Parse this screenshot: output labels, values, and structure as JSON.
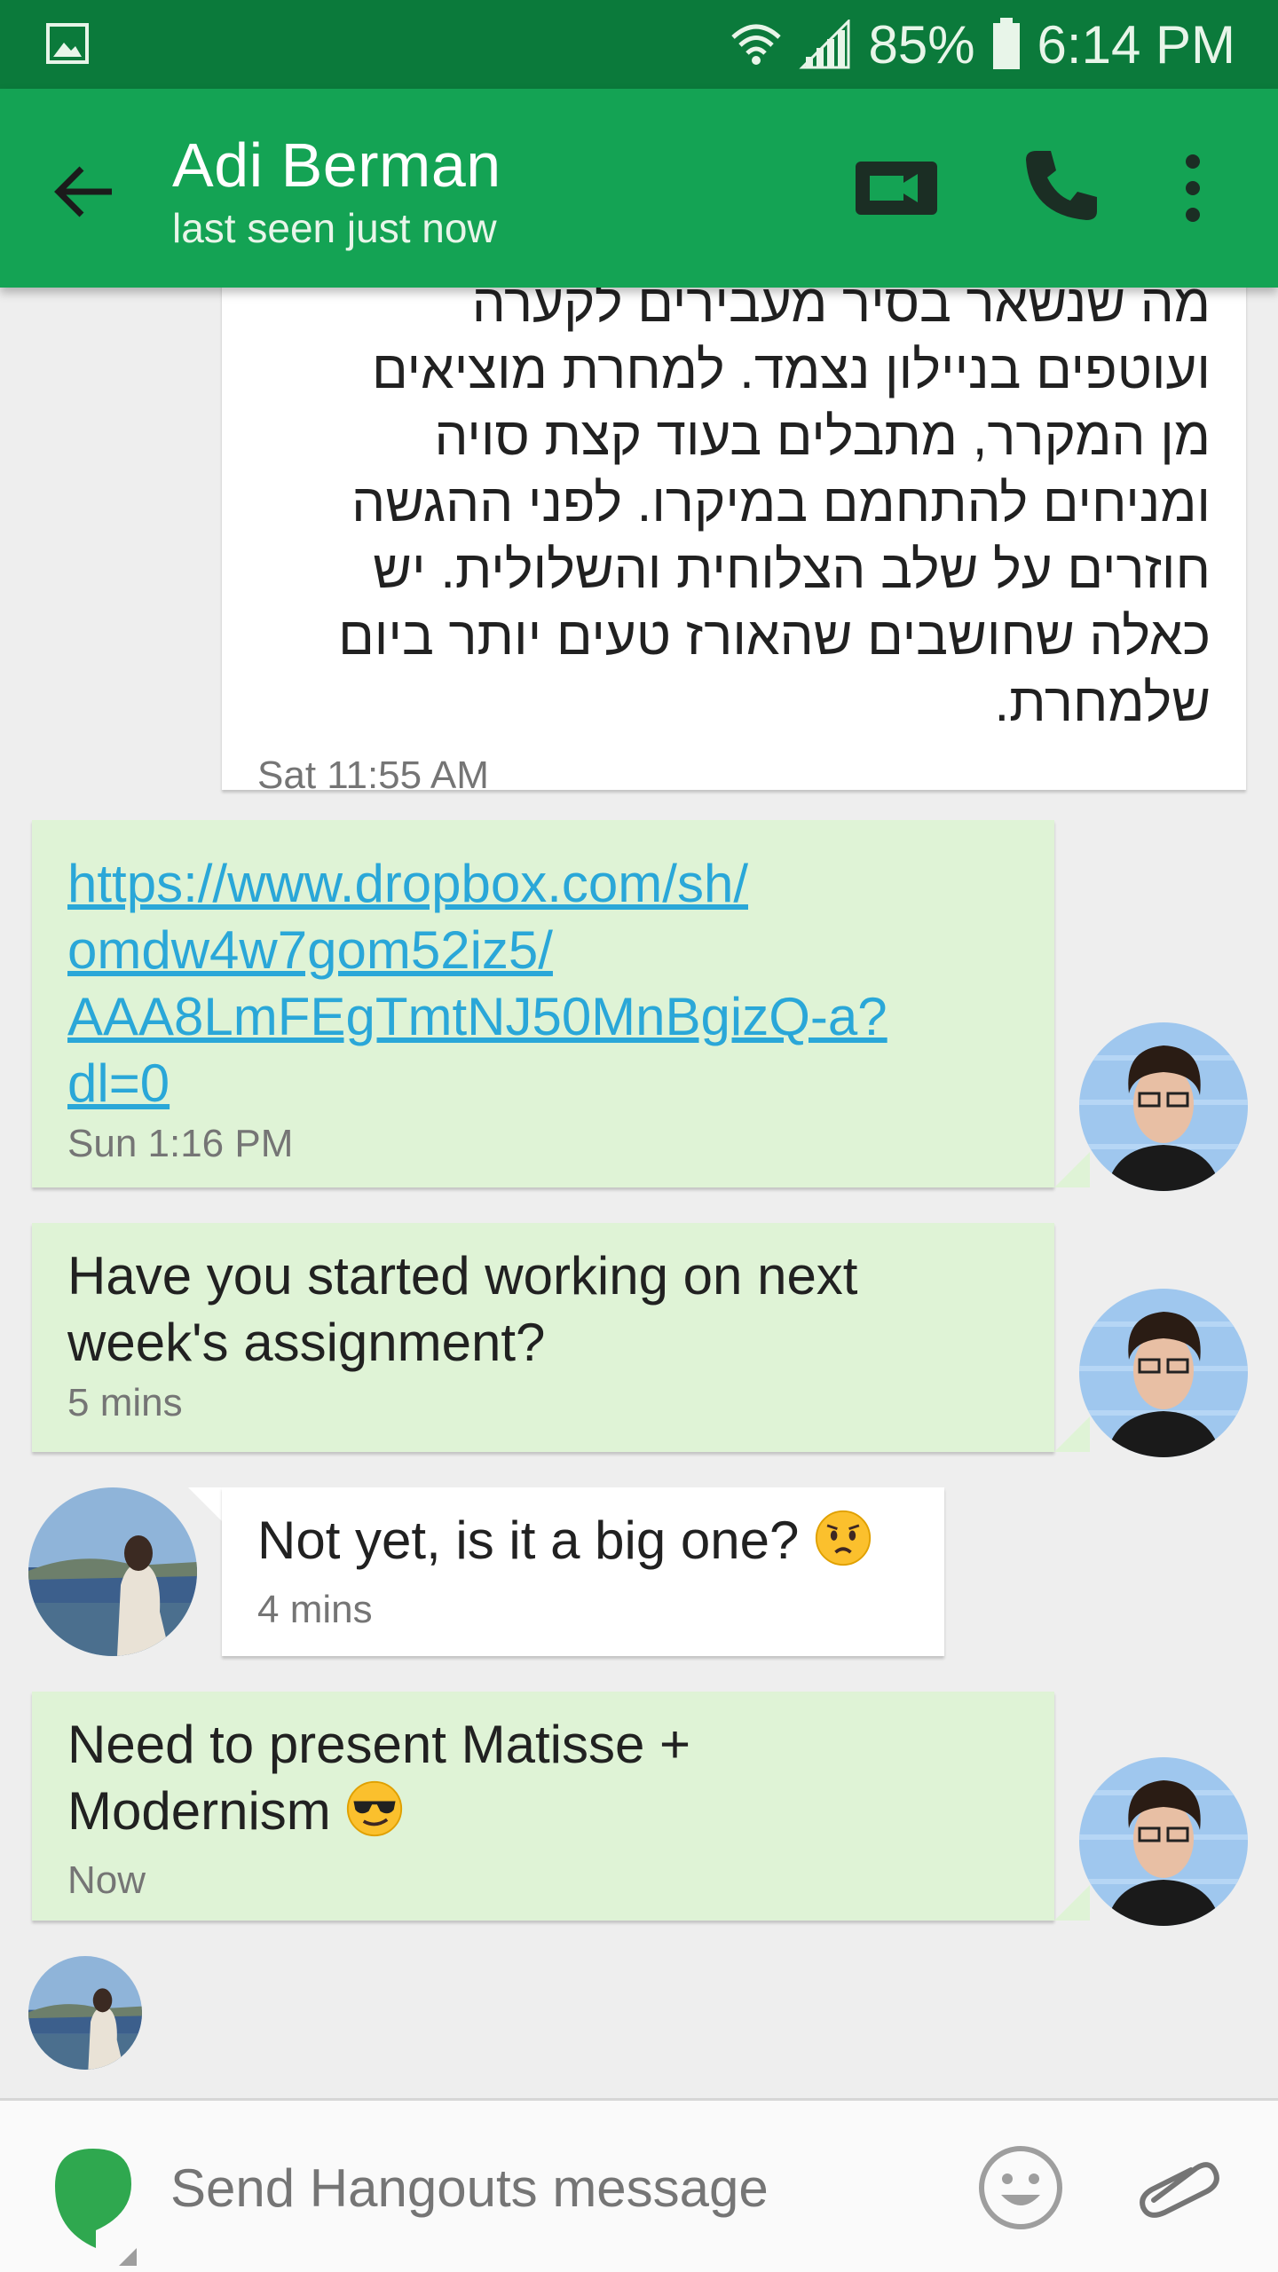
{
  "status_bar": {
    "battery": "85%",
    "time": "6:14 PM"
  },
  "header": {
    "contact_name": "Adi Berman",
    "contact_status": "last seen just now"
  },
  "messages": [
    {
      "direction": "incoming",
      "lines": [
        "ועוטפים בניילון נצמד. למחרת מוציאים",
        "מן המקרר, מתבלים בעוד קצת סויה",
        "ומניחים להתחמם במיקרו. לפני ההגשה",
        "חוזרים על שלב הצלוחית והשלולית. יש",
        "כאלה שחושבים שהאורז טעים יותר ביום",
        "שלמחרת."
      ],
      "time": "Sat 11:55 AM"
    },
    {
      "direction": "outgoing",
      "link_lines": [
        "https://www.dropbox.com/sh/",
        "omdw4w7gom52iz5/",
        "AAA8LmFEgTmtNJ50MnBgizQ-a?",
        "dl=0"
      ],
      "time": "Sun 1:16 PM"
    },
    {
      "direction": "outgoing",
      "lines": [
        "Have you started working on next",
        "week's assignment?"
      ],
      "time": "5 mins"
    },
    {
      "direction": "incoming",
      "text": "Not yet, is it a big one?",
      "emoji": "worried-face",
      "time": "4 mins"
    },
    {
      "direction": "outgoing",
      "lines": [
        "Need to present Matisse +",
        "Modernism"
      ],
      "emoji": "sunglasses-face",
      "time": "Now"
    }
  ],
  "composer": {
    "placeholder": "Send Hangouts message"
  },
  "colors": {
    "status_bar": "#0b7a3b",
    "app_bar": "#14a354",
    "outgoing_bubble": "#dff3d6",
    "incoming_bubble": "#ffffff",
    "link": "#2aa7d8"
  }
}
